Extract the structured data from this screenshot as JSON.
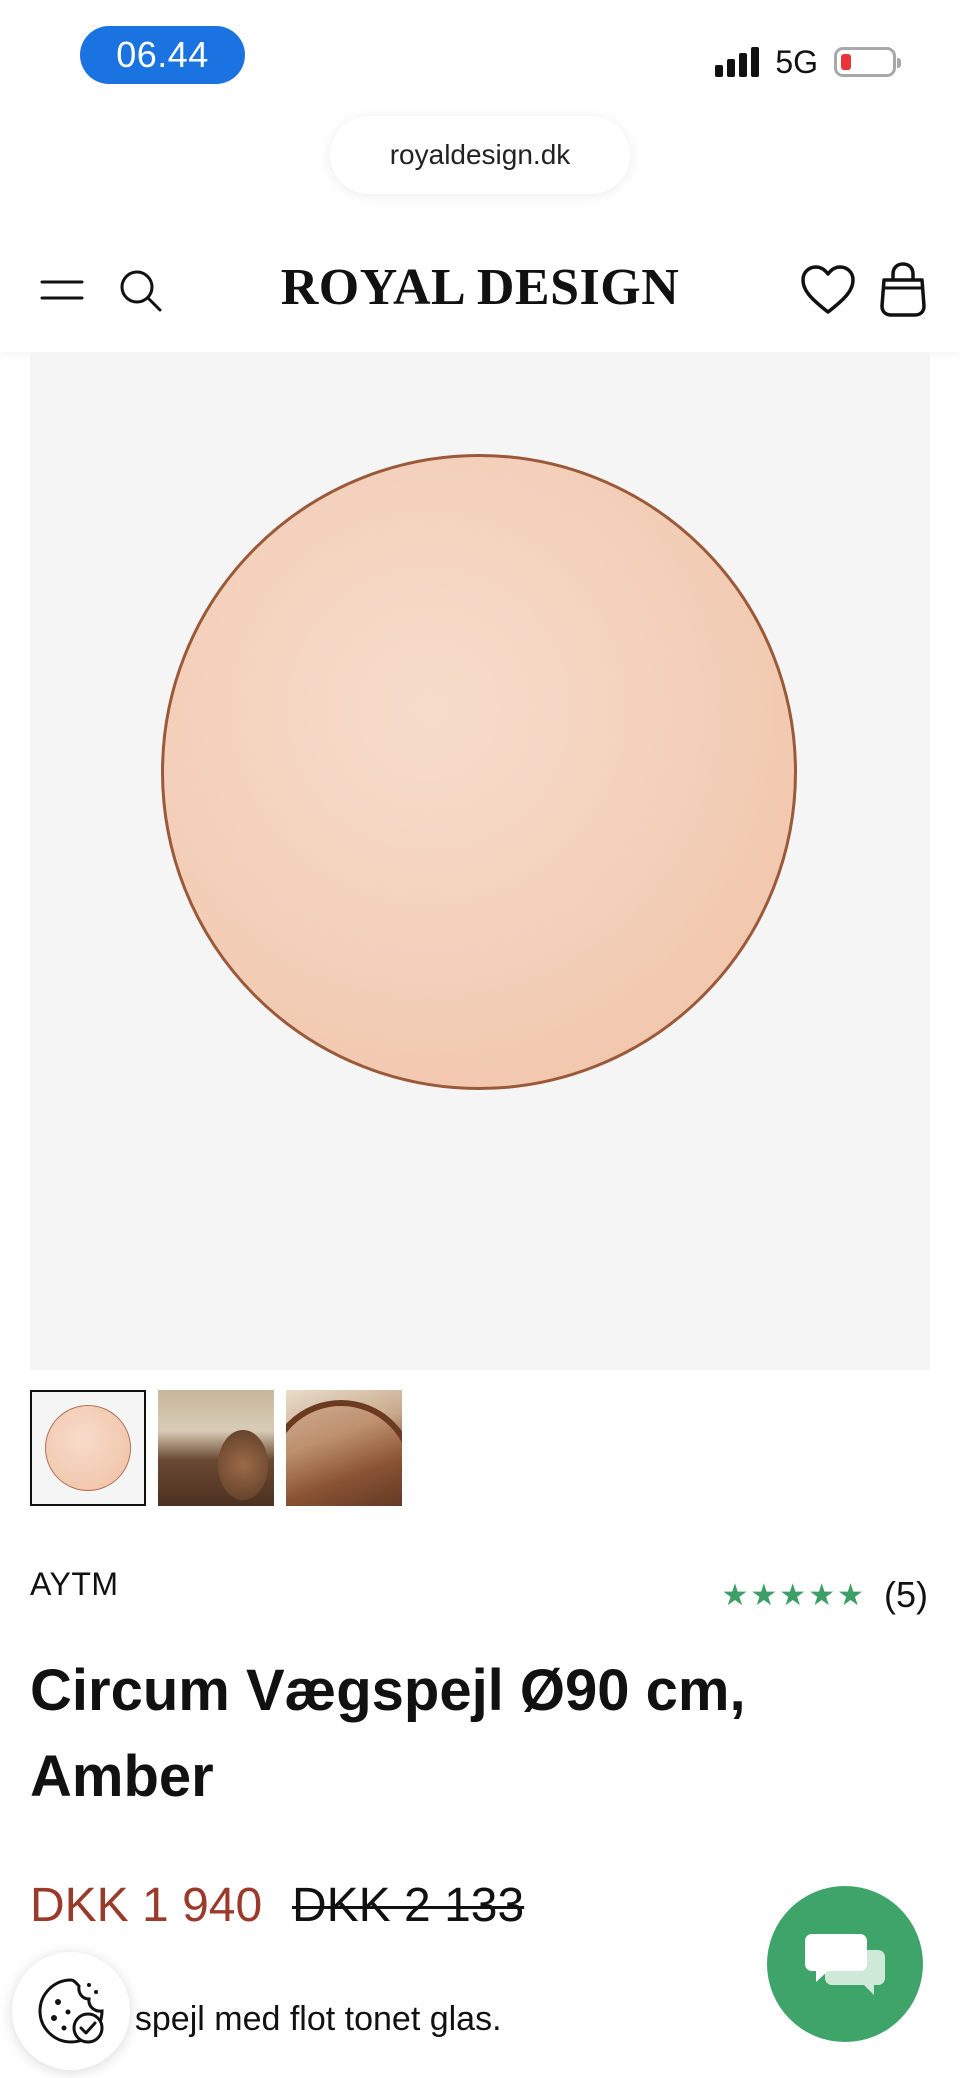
{
  "status_bar": {
    "time": "06.44",
    "network": "5G"
  },
  "browser": {
    "url": "royaldesign.dk"
  },
  "header": {
    "logo": "ROYAL DESIGN",
    "icons": [
      "menu-icon",
      "search-icon",
      "heart-icon",
      "shopping-bag-icon"
    ]
  },
  "gallery": {
    "thumbnails": [
      "thumbnail-mirror-front",
      "thumbnail-room-scene",
      "thumbnail-mirror-detail"
    ],
    "active_index": 0
  },
  "product": {
    "brand": "AYTM",
    "rating_stars": "★★★★★",
    "rating_value": 5,
    "review_count": "(5)",
    "title": "Circum Vægspejl Ø90 cm, Amber",
    "price_current": "DKK 1 940",
    "price_original": "DKK 2 133",
    "description_partial": "t spejl med flot tonet glas."
  },
  "colors": {
    "accent_sale": "#9a3a2a",
    "rating_green": "#3d9e67",
    "chat_green": "#3fa46a",
    "time_pill_blue": "#1a73e0"
  },
  "floating": {
    "cookie_icon": "cookie-settings-icon",
    "chat_icon": "chat-bubbles-icon"
  }
}
